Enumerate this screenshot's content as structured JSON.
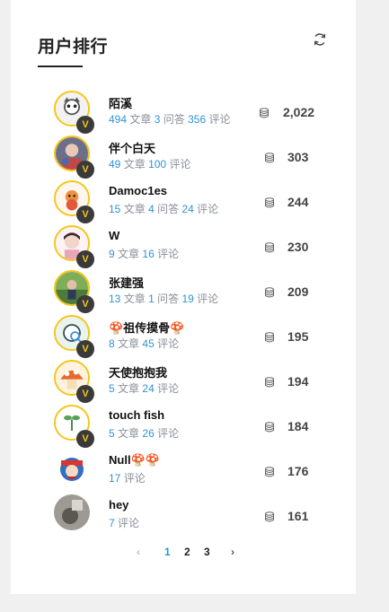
{
  "panel": {
    "title": "用户排行",
    "refresh_icon": "refresh-icon"
  },
  "colors": {
    "accent_blue": "#2f93d6",
    "badge_yellow": "#f5c518",
    "badge_dark": "#3a3a3a"
  },
  "badge_label": "V",
  "users": [
    {
      "name": "陌溪",
      "stats": [
        [
          "494",
          "文章"
        ],
        [
          "3",
          "问答"
        ],
        [
          "356",
          "评论"
        ]
      ],
      "score": "2,022",
      "vip": true
    },
    {
      "name": "伴个白天",
      "stats": [
        [
          "49",
          "文章"
        ],
        [
          "100",
          "评论"
        ]
      ],
      "score": "303",
      "vip": true
    },
    {
      "name": "Damoc1es",
      "stats": [
        [
          "15",
          "文章"
        ],
        [
          "4",
          "问答"
        ],
        [
          "24",
          "评论"
        ]
      ],
      "score": "244",
      "vip": true
    },
    {
      "name": "W",
      "stats": [
        [
          "9",
          "文章"
        ],
        [
          "16",
          "评论"
        ]
      ],
      "score": "230",
      "vip": true
    },
    {
      "name": "张建强",
      "stats": [
        [
          "13",
          "文章"
        ],
        [
          "1",
          "问答"
        ],
        [
          "19",
          "评论"
        ]
      ],
      "score": "209",
      "vip": true
    },
    {
      "name": "🍄祖传摸骨🍄",
      "stats": [
        [
          "8",
          "文章"
        ],
        [
          "45",
          "评论"
        ]
      ],
      "score": "195",
      "vip": true
    },
    {
      "name": "天使抱抱我",
      "stats": [
        [
          "5",
          "文章"
        ],
        [
          "24",
          "评论"
        ]
      ],
      "score": "194",
      "vip": true
    },
    {
      "name": "touch fish",
      "stats": [
        [
          "5",
          "文章"
        ],
        [
          "26",
          "评论"
        ]
      ],
      "score": "184",
      "vip": true
    },
    {
      "name": "Null🍄🍄",
      "stats": [
        [
          "17",
          "评论"
        ]
      ],
      "score": "176",
      "vip": false
    },
    {
      "name": "hey",
      "stats": [
        [
          "7",
          "评论"
        ]
      ],
      "score": "161",
      "vip": false
    }
  ],
  "pagination": {
    "prev": "‹",
    "pages": [
      "1",
      "2",
      "3"
    ],
    "current": "1",
    "next": "›"
  }
}
